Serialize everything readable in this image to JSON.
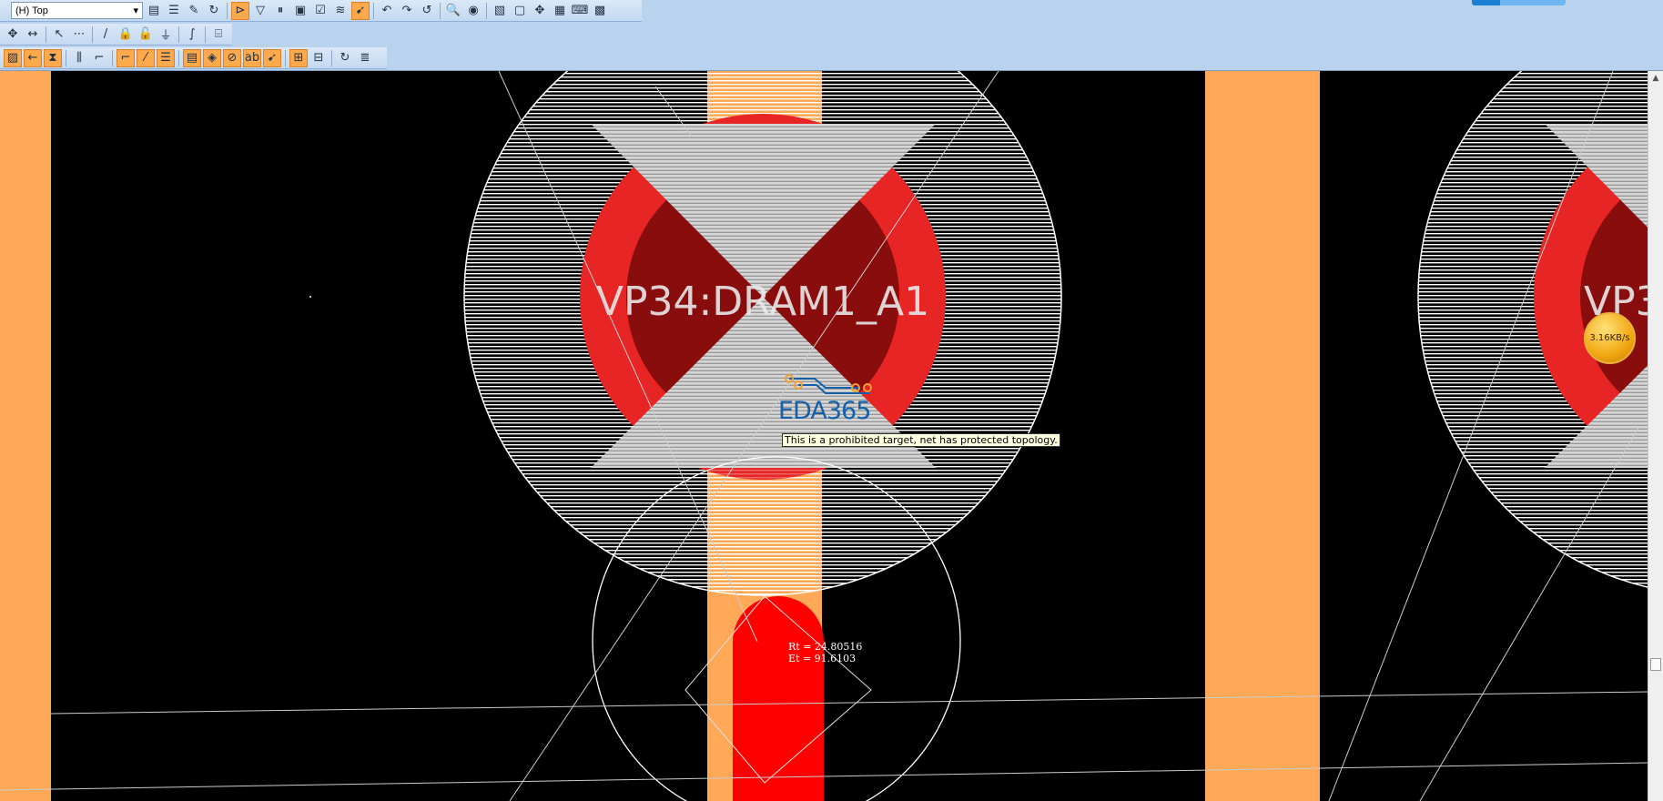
{
  "toolbar": {
    "layer_select": "(H) Top",
    "row1": [
      {
        "n": "properties-icon",
        "g": "▤"
      },
      {
        "n": "list-icon",
        "g": "☰"
      },
      {
        "n": "brush-icon",
        "g": "✎"
      },
      {
        "n": "refresh-icon",
        "g": "↻"
      },
      {
        "sep": 1
      },
      {
        "n": "select-filter-icon",
        "g": "⊳",
        "on": 1
      },
      {
        "n": "drc-filter-icon",
        "g": "▽"
      },
      {
        "n": "pause-icon",
        "g": "⏸"
      },
      {
        "n": "net-icon",
        "g": "▣"
      },
      {
        "n": "document-check-icon",
        "g": "☑"
      },
      {
        "n": "nets-icon",
        "g": "≋"
      },
      {
        "n": "select-nets-icon",
        "g": "➹",
        "on": 1
      },
      {
        "sep": 1
      },
      {
        "n": "undo-icon",
        "g": "↶"
      },
      {
        "n": "redo-icon",
        "g": "↷"
      },
      {
        "n": "redraw-icon",
        "g": "↺"
      },
      {
        "sep": 1
      },
      {
        "n": "zoom-icon",
        "g": "🔍"
      },
      {
        "n": "view-icon",
        "g": "◉"
      },
      {
        "sep": 1
      },
      {
        "n": "picture-icon",
        "g": "▧"
      },
      {
        "n": "window-icon",
        "g": "▢"
      },
      {
        "n": "pan-icon",
        "g": "✥"
      },
      {
        "n": "table-icon",
        "g": "▦"
      },
      {
        "n": "keyboard-icon",
        "g": "⌨"
      },
      {
        "n": "pads-icon",
        "g": "▩"
      }
    ],
    "row2": [
      {
        "n": "move-icon",
        "g": "✥"
      },
      {
        "n": "stretch-icon",
        "g": "↔"
      },
      {
        "sep": 1
      },
      {
        "n": "select-icon",
        "g": "↖"
      },
      {
        "n": "area-select-icon",
        "g": "⋯"
      },
      {
        "sep": 1
      },
      {
        "n": "route-icon",
        "g": "/"
      },
      {
        "n": "lock-icon",
        "g": "🔒"
      },
      {
        "n": "unlock-icon",
        "g": "🔓"
      },
      {
        "n": "via-icon",
        "g": "⏚"
      },
      {
        "sep": 1
      },
      {
        "n": "arc-icon",
        "g": "∫"
      },
      {
        "sep": 1
      },
      {
        "n": "tune-icon",
        "g": "⌸"
      }
    ],
    "row3": [
      {
        "n": "board-icon",
        "g": "▨",
        "on": 1
      },
      {
        "n": "back-icon",
        "g": "←",
        "on": 1
      },
      {
        "n": "hourglass-icon",
        "g": "⧗",
        "on": 1
      },
      {
        "sep": 1
      },
      {
        "n": "bus-route-icon",
        "g": "⫼"
      },
      {
        "n": "corner-icon",
        "g": "⌐"
      },
      {
        "sep": 1
      },
      {
        "n": "angle-route-icon",
        "g": "⌐",
        "on": 1
      },
      {
        "n": "diagonal-route-icon",
        "g": "⁄",
        "on": 1
      },
      {
        "n": "layers-icon",
        "g": "☰",
        "on": 1
      },
      {
        "sep": 1
      },
      {
        "n": "plane-icon",
        "g": "▤",
        "on": 1
      },
      {
        "n": "copper-icon",
        "g": "◈",
        "on": 1
      },
      {
        "n": "keepout-icon",
        "g": "⊘",
        "on": 1
      },
      {
        "n": "text-icon",
        "g": "ab",
        "on": 1
      },
      {
        "n": "pointer-icon",
        "g": "➹",
        "on": 1
      },
      {
        "sep": 1
      },
      {
        "n": "component-icon",
        "g": "⊞",
        "on": 1
      },
      {
        "n": "cluster-icon",
        "g": "⊟"
      },
      {
        "sep": 1
      },
      {
        "n": "sync-icon",
        "g": "↻"
      },
      {
        "n": "stack-icon",
        "g": "≣"
      }
    ]
  },
  "canvas": {
    "pad_label": "VP34:DRAM1_A1",
    "pad_label_right": "VP3",
    "rt": "Rt = 24.80516",
    "et": "Et = 91.6103",
    "tooltip": "This is a prohibited target, net has protected topology.",
    "logo": "EDA365",
    "colors": {
      "trace": "#ffa857",
      "pad": "#ff0000",
      "hatch": "#ffffff",
      "keepout": "#d8d8d8"
    }
  },
  "speed_badge": "3.16KB/s"
}
